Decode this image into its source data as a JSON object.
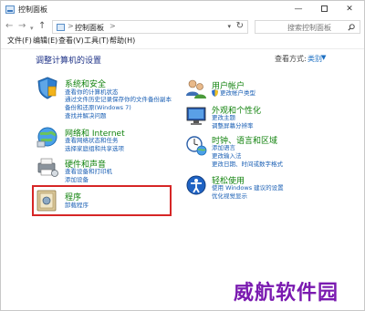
{
  "window": {
    "title": "控制面板",
    "minimize": "—",
    "close": "✕"
  },
  "address_bar": {
    "separator": ">",
    "path": "控制面板",
    "search_placeholder": "搜索控制面板"
  },
  "menu": [
    "文件(F)",
    "编辑(E)",
    "查看(V)",
    "工具(T)",
    "帮助(H)"
  ],
  "page": {
    "title": "调整计算机的设置",
    "view_by_label": "查看方式:",
    "view_by_value": "类别"
  },
  "categories": {
    "system_security": {
      "title": "系统和安全",
      "icon": "shield-icon",
      "links": [
        "查看你的计算机状态",
        "通过文件历史记录保存你的文件备份副本",
        "备份和还原(Windows 7)",
        "查找并解决问题"
      ]
    },
    "network": {
      "title": "网络和 Internet",
      "icon": "network-icon",
      "links": [
        "查看网络状态和任务",
        "选择家庭组和共享选项"
      ]
    },
    "hardware": {
      "title": "硬件和声音",
      "icon": "printer-icon",
      "links": [
        "查看设备和打印机",
        "添加设备"
      ]
    },
    "programs": {
      "title": "程序",
      "icon": "programs-icon",
      "links": [
        "卸载程序"
      ]
    },
    "user_accounts": {
      "title": "用户帐户",
      "icon": "users-icon",
      "links": [
        "更改帐户类型"
      ]
    },
    "appearance": {
      "title": "外观和个性化",
      "icon": "appearance-icon",
      "links": [
        "更改主题",
        "调整屏幕分辨率"
      ]
    },
    "clock": {
      "title": "时钟、语言和区域",
      "icon": "clock-globe-icon",
      "links": [
        "添加语言",
        "更改输入法",
        "更改日期、时间或数字格式"
      ]
    },
    "ease": {
      "title": "轻松使用",
      "icon": "ease-of-access-icon",
      "links": [
        "使用 Windows 建议的设置",
        "优化视觉显示"
      ]
    }
  },
  "watermark": "威航软件园"
}
